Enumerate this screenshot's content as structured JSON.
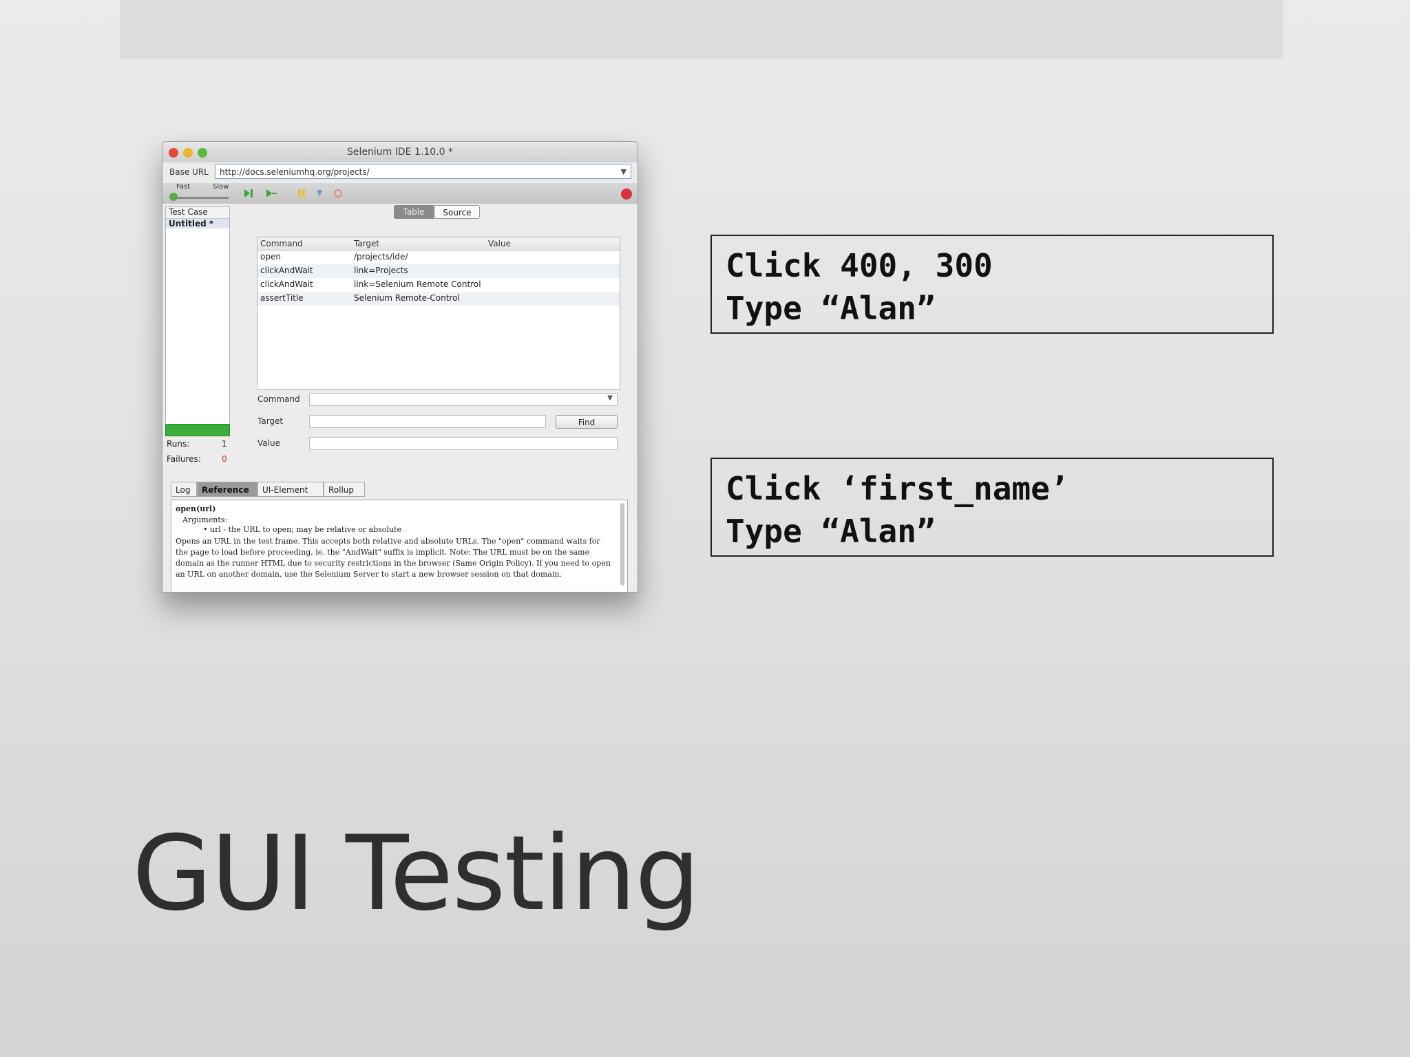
{
  "slide": {
    "title": "GUI Testing",
    "box1": {
      "line1": "Click 400, 300",
      "line2": "Type “Alan”"
    },
    "box2": {
      "line1": "Click ‘first_name’",
      "line2": "Type “Alan”"
    }
  },
  "ide": {
    "window_title": "Selenium IDE 1.10.0 *",
    "base_url_label": "Base URL",
    "base_url_value": "http://docs.seleniumhq.org/projects/",
    "speed_fast": "Fast",
    "speed_slow": "Slow",
    "test_case_header": "Test Case",
    "test_case_item": "Untitled *",
    "runs_label": "Runs:",
    "runs_value": "1",
    "failures_label": "Failures:",
    "failures_value": "0",
    "tabs": {
      "table": "Table",
      "source": "Source"
    },
    "columns": {
      "command": "Command",
      "target": "Target",
      "value": "Value"
    },
    "rows": [
      {
        "command": "open",
        "target": "/projects/ide/"
      },
      {
        "command": "clickAndWait",
        "target": "link=Projects"
      },
      {
        "command": "clickAndWait",
        "target": "link=Selenium Remote Control"
      },
      {
        "command": "assertTitle",
        "target": "Selenium Remote-Control"
      }
    ],
    "fields": {
      "command": "Command",
      "target": "Target",
      "value": "Value",
      "find": "Find"
    },
    "bottom_tabs": {
      "log": "Log",
      "reference": "Reference",
      "ui_element": "UI-Element",
      "rollup": "Rollup"
    },
    "reference": {
      "title": "open(url)",
      "args": "Arguments:",
      "bullet": "url - the URL to open; may be relative or absolute",
      "body": "Opens an URL in the test frame. This accepts both relative and absolute URLs. The \"open\" command waits for the page to load before proceeding, ie. the \"AndWait\" suffix is implicit. Note: The URL must be on the same domain as the runner HTML due to security restrictions in the browser (Same Origin Policy). If you need to open an URL on another domain, use the Selenium Server to start a new browser session on that domain."
    },
    "colors": {
      "record": "#d8323a",
      "progress": "#3aae3a",
      "play": "#3aa63a"
    }
  }
}
